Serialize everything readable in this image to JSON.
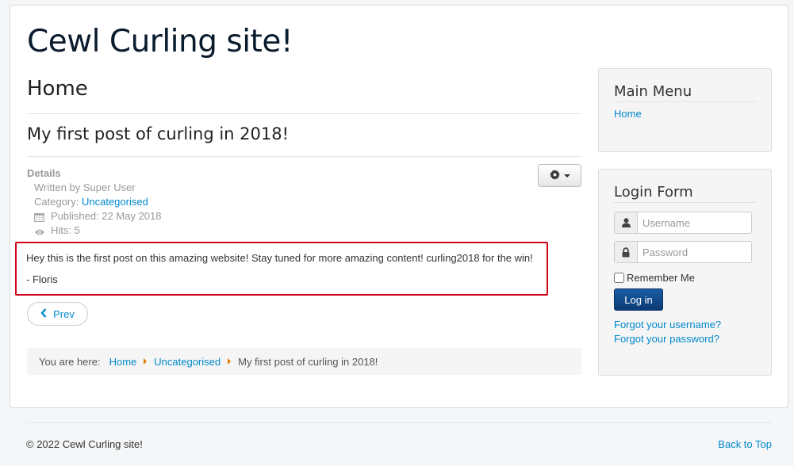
{
  "site": {
    "title": "Cewl Curling site!"
  },
  "page": {
    "header": "Home"
  },
  "article": {
    "title": "My first post of curling in 2018!",
    "details_label": "Details",
    "author": "Written by Super User",
    "category_label": "Category: ",
    "category_link": "Uncategorised",
    "published": "Published: 22 May 2018",
    "hits": "Hits: 5",
    "body_line1": "Hey this is the first post on this amazing website! Stay tuned for more amazing content! curling2018 for the win!",
    "body_line2": "- Floris",
    "prev_label": "Prev",
    "tools_icon": "gear-icon"
  },
  "breadcrumb": {
    "here": "You are here:",
    "items": [
      "Home",
      "Uncategorised"
    ],
    "current": "My first post of curling in 2018!"
  },
  "main_menu": {
    "title": "Main Menu",
    "items": [
      "Home"
    ]
  },
  "login": {
    "title": "Login Form",
    "username_placeholder": "Username",
    "password_placeholder": "Password",
    "remember_label": "Remember Me",
    "login_button": "Log in",
    "forgot_username": "Forgot your username?",
    "forgot_password": "Forgot your password?"
  },
  "footer": {
    "copyright": "© 2022 Cewl Curling site!",
    "back_to_top": "Back to Top"
  },
  "colors": {
    "link": "#0088cc",
    "highlight_border": "#d0021b",
    "login_button": "#0b3b74",
    "breadcrumb_separator": "#e07b00"
  }
}
